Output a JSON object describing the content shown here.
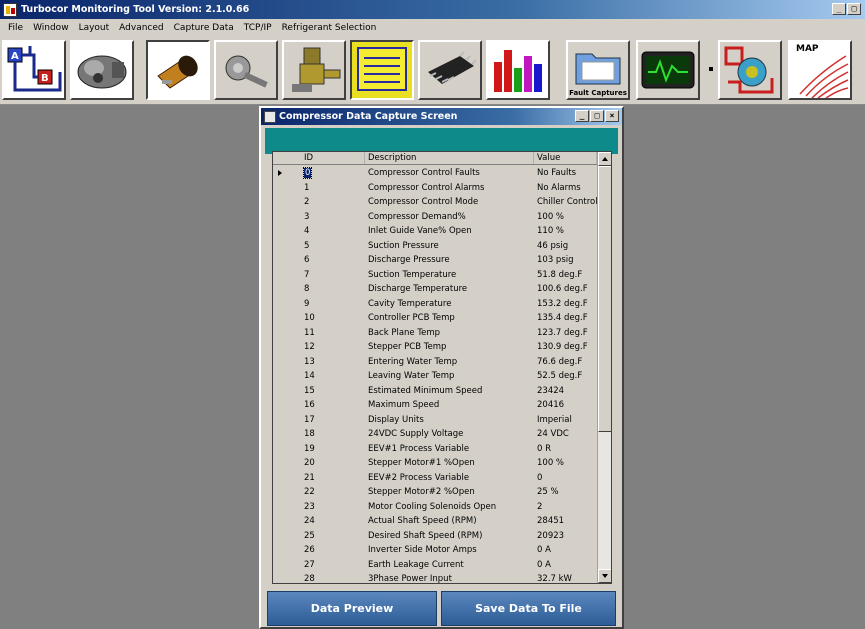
{
  "app": {
    "title": "Turbocor Monitoring Tool Version: 2.1.0.66",
    "controls": [
      "_",
      "□"
    ]
  },
  "menu": [
    "File",
    "Window",
    "Layout",
    "Advanced",
    "Capture Data",
    "TCP/IP",
    "Refrigerant Selection"
  ],
  "toolbar": {
    "buttons": [
      {
        "name": "schematic-icon"
      },
      {
        "name": "compressor-icon"
      },
      {
        "name": "motor-icon"
      },
      {
        "name": "impeller-icon"
      },
      {
        "name": "valve-icon"
      },
      {
        "name": "notepad-icon"
      },
      {
        "name": "chip-icon"
      },
      {
        "name": "bar-chart-icon"
      },
      {
        "name": "fault-captures-icon",
        "caption": "Fault Captures"
      },
      {
        "name": "oscilloscope-icon"
      },
      {
        "name": "system-diagram-icon"
      },
      {
        "name": "map-icon",
        "caption": "MAP"
      }
    ]
  },
  "child_window": {
    "title": "Compressor Data Capture Screen",
    "controls": [
      "_",
      "□",
      "×"
    ],
    "columns": [
      "ID",
      "Description",
      "Value"
    ],
    "rows": [
      {
        "id": "0",
        "desc": "Compressor Control Faults",
        "val": "No Faults"
      },
      {
        "id": "1",
        "desc": "Compressor Control Alarms",
        "val": "No Alarms"
      },
      {
        "id": "2",
        "desc": "Compressor Control Mode",
        "val": "Chiller Control"
      },
      {
        "id": "3",
        "desc": "Compressor Demand%",
        "val": "100 %"
      },
      {
        "id": "4",
        "desc": "Inlet Guide Vane% Open",
        "val": "110 %"
      },
      {
        "id": "5",
        "desc": "Suction Pressure",
        "val": "46 psig"
      },
      {
        "id": "6",
        "desc": "Discharge Pressure",
        "val": "103 psig"
      },
      {
        "id": "7",
        "desc": "Suction Temperature",
        "val": "51.8 deg.F"
      },
      {
        "id": "8",
        "desc": "Discharge Temperature",
        "val": "100.6 deg.F"
      },
      {
        "id": "9",
        "desc": "Cavity Temperature",
        "val": "153.2 deg.F"
      },
      {
        "id": "10",
        "desc": "Controller PCB Temp",
        "val": "135.4 deg.F"
      },
      {
        "id": "11",
        "desc": "Back Plane Temp",
        "val": "123.7 deg.F"
      },
      {
        "id": "12",
        "desc": "Stepper PCB Temp",
        "val": "130.9 deg.F"
      },
      {
        "id": "13",
        "desc": "Entering Water Temp",
        "val": "76.6 deg.F"
      },
      {
        "id": "14",
        "desc": "Leaving Water Temp",
        "val": "52.5 deg.F"
      },
      {
        "id": "15",
        "desc": "Estimated Minimum Speed",
        "val": "23424"
      },
      {
        "id": "16",
        "desc": "Maximum Speed",
        "val": "20416"
      },
      {
        "id": "17",
        "desc": "Display Units",
        "val": "Imperial"
      },
      {
        "id": "18",
        "desc": "24VDC Supply Voltage",
        "val": "24 VDC"
      },
      {
        "id": "19",
        "desc": "EEV#1 Process Variable",
        "val": "0 R"
      },
      {
        "id": "20",
        "desc": "Stepper Motor#1 %Open",
        "val": "100 %"
      },
      {
        "id": "21",
        "desc": "EEV#2 Process Variable",
        "val": "0"
      },
      {
        "id": "22",
        "desc": "Stepper Motor#2 %Open",
        "val": "25 %"
      },
      {
        "id": "23",
        "desc": "Motor Cooling Solenoids Open",
        "val": "2"
      },
      {
        "id": "24",
        "desc": "Actual Shaft Speed (RPM)",
        "val": "28451"
      },
      {
        "id": "25",
        "desc": "Desired Shaft Speed (RPM)",
        "val": "20923"
      },
      {
        "id": "26",
        "desc": "Inverter Side Motor Amps",
        "val": "0 A"
      },
      {
        "id": "27",
        "desc": "Earth Leakage Current",
        "val": "0 A"
      },
      {
        "id": "28",
        "desc": "3Phase Power Input",
        "val": "32.7 kW"
      }
    ],
    "buttons": {
      "preview": "Data Preview",
      "save": "Save Data To File"
    }
  },
  "colors": {
    "title_bar": "#0a246a",
    "teal_bar": "#0f8a8a",
    "button_blue": "#3a6aa5",
    "desktop_gray": "#808080"
  }
}
